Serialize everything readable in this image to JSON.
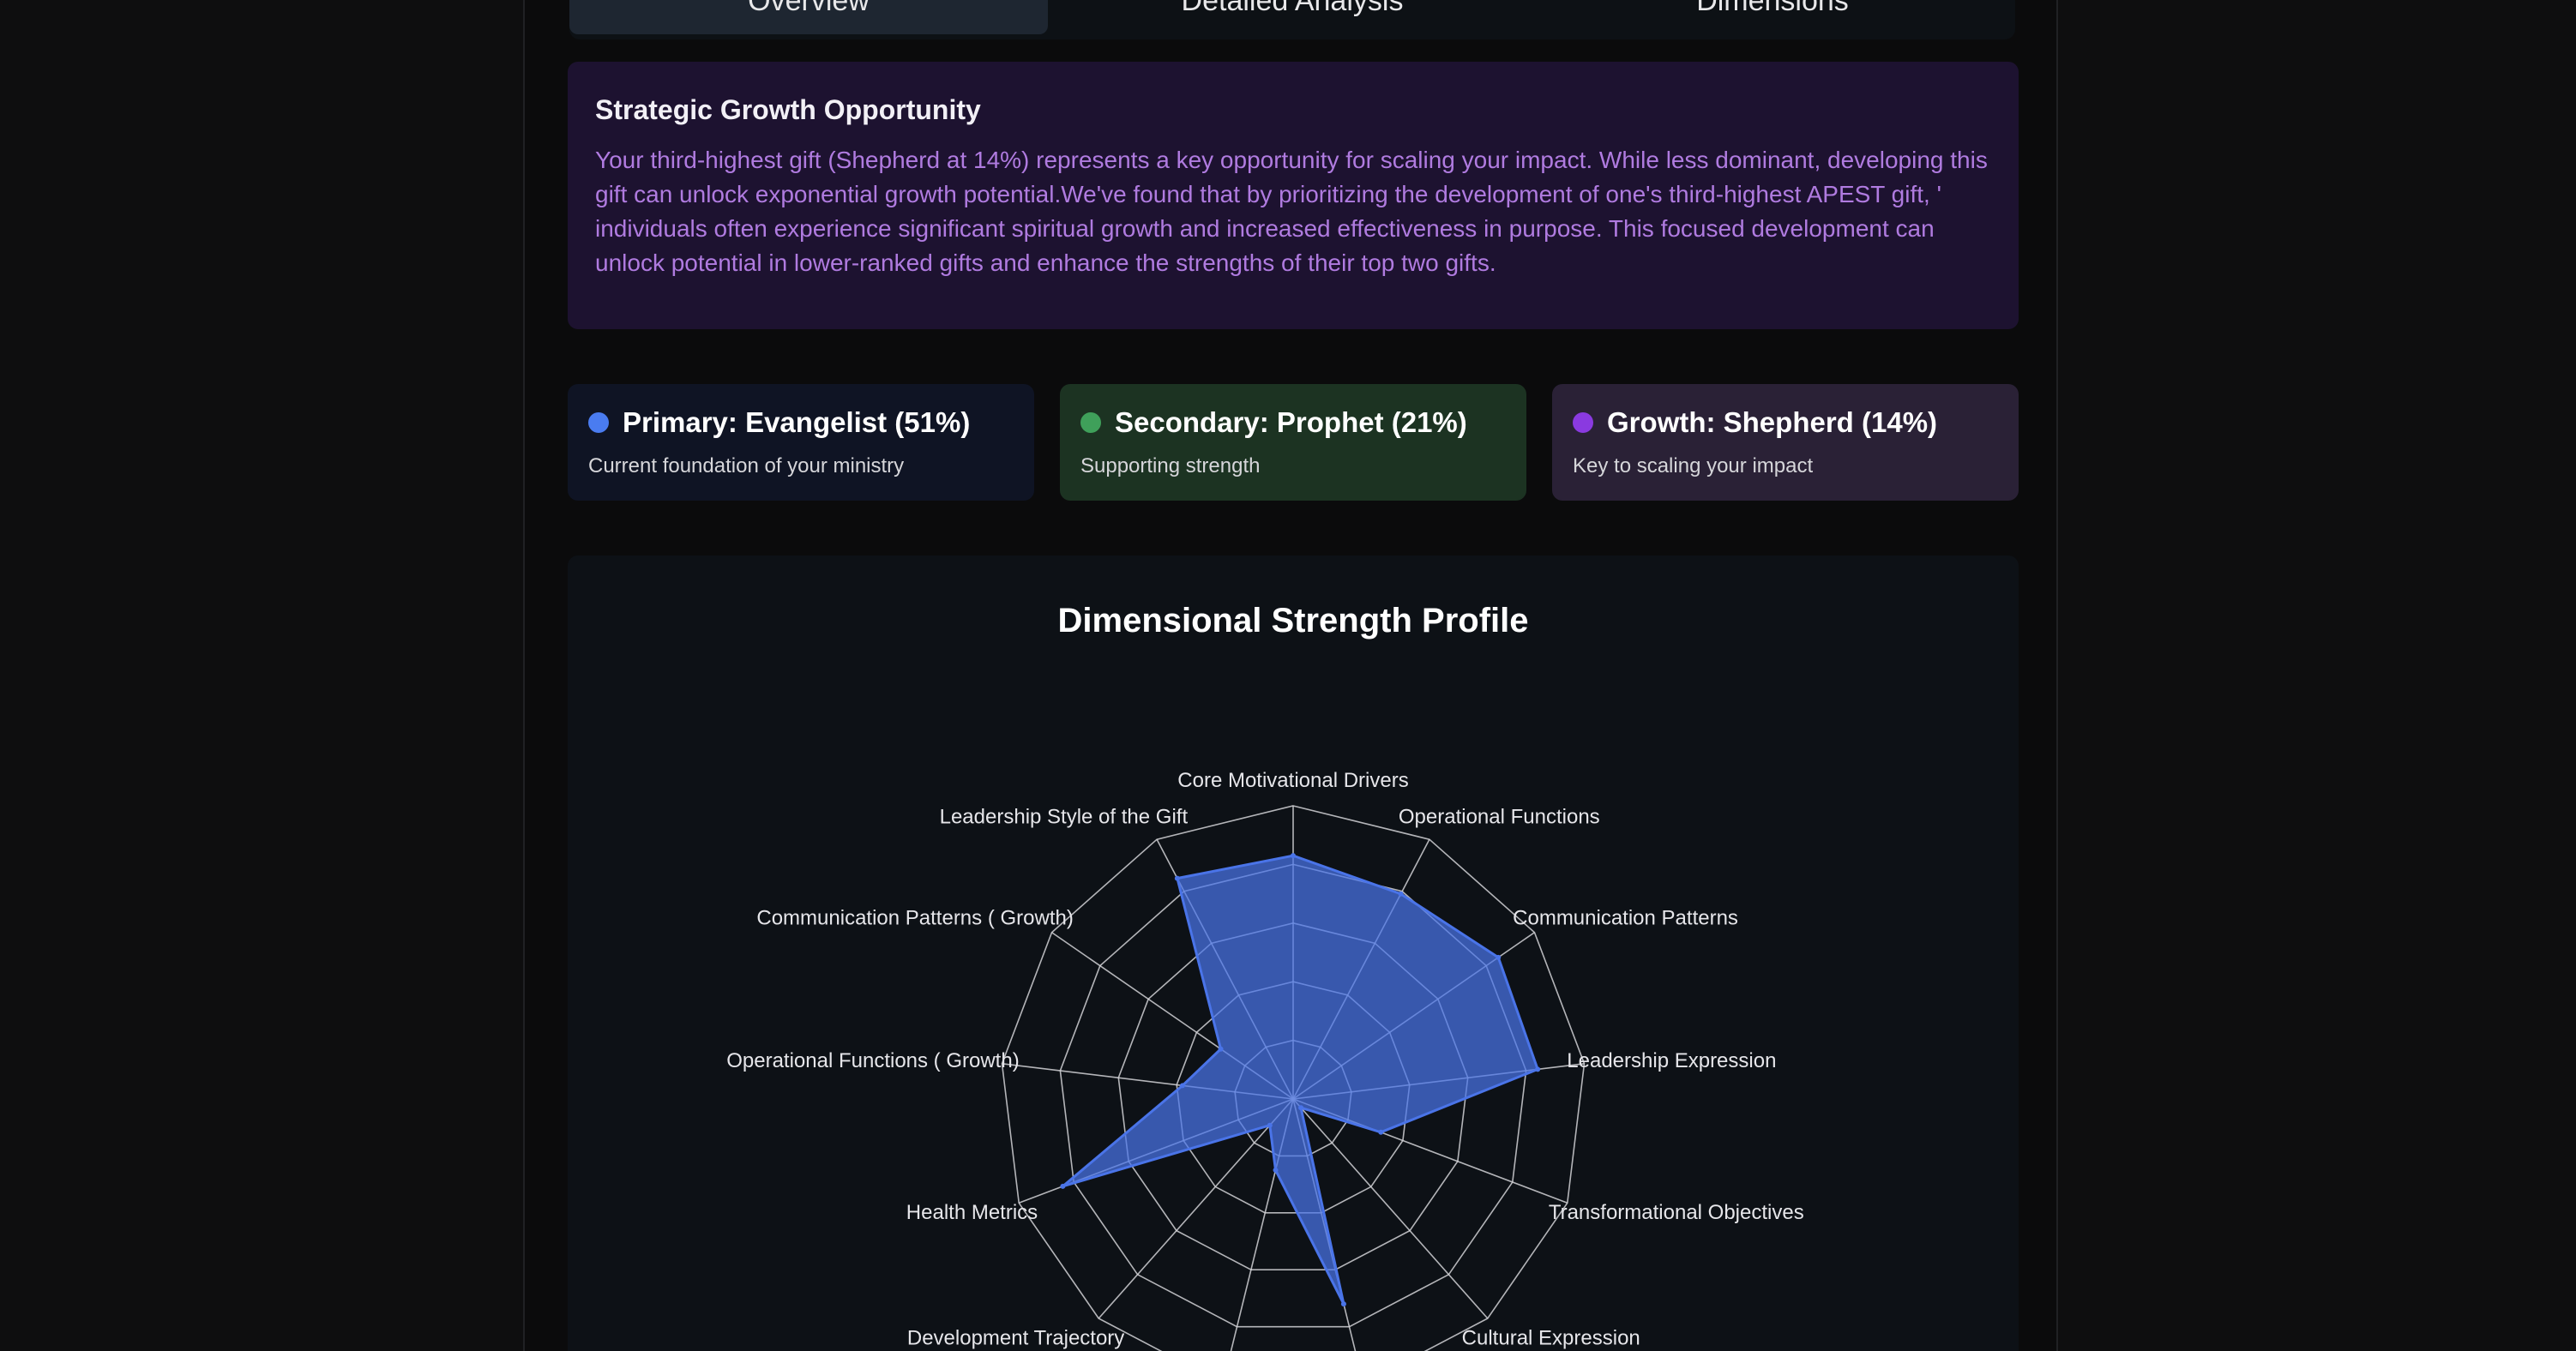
{
  "tabs": [
    {
      "label": "Overview",
      "active": true
    },
    {
      "label": "Detailed Analysis",
      "active": false
    },
    {
      "label": "Dimensions",
      "active": false
    }
  ],
  "growth": {
    "title": "Strategic Growth Opportunity",
    "text": "Your third-highest gift (Shepherd at 14%) represents a key opportunity for scaling your impact. While less dominant, developing this gift can unlock exponential growth potential.We've found that by prioritizing the development of one's third-highest APEST gift, ' individuals often experience significant spiritual growth and increased effectiveness in purpose. This focused development can unlock potential in lower-ranked gifts and enhance the strengths of their top two gifts."
  },
  "cards": [
    {
      "title": "Primary: Evangelist (51%)",
      "subtitle": "Current foundation of your ministry",
      "dot_color": "#4a7cf0",
      "bg_color": "#0f1424"
    },
    {
      "title": "Secondary: Prophet (21%)",
      "subtitle": "Supporting strength",
      "dot_color": "#3fa05a",
      "bg_color": "#1c3322"
    },
    {
      "title": "Growth: Shepherd (14%)",
      "subtitle": "Key to scaling your impact",
      "dot_color": "#8a3ae0",
      "bg_color": "#2a2136"
    }
  ],
  "chart_data": {
    "type": "radar",
    "title": "Dimensional Strength Profile",
    "axis_max": 100,
    "rings": [
      20,
      40,
      60,
      80,
      100
    ],
    "grid": true,
    "fill_color": "#4a74e8",
    "categories": [
      "Core Motivational Drivers",
      "Operational Functions",
      "Communication Patterns",
      "Leadership Expression",
      "Transformational Objectives",
      "Cultural Expression",
      "",
      "",
      "Development Trajectory",
      "Health Metrics",
      "Operational Functions ( Growth)",
      "Communication Patterns ( Growth)",
      "Leadership Style of the Gift"
    ],
    "values": [
      83,
      79,
      85,
      84,
      32,
      4,
      72,
      25,
      12,
      84,
      38,
      30,
      85
    ]
  }
}
